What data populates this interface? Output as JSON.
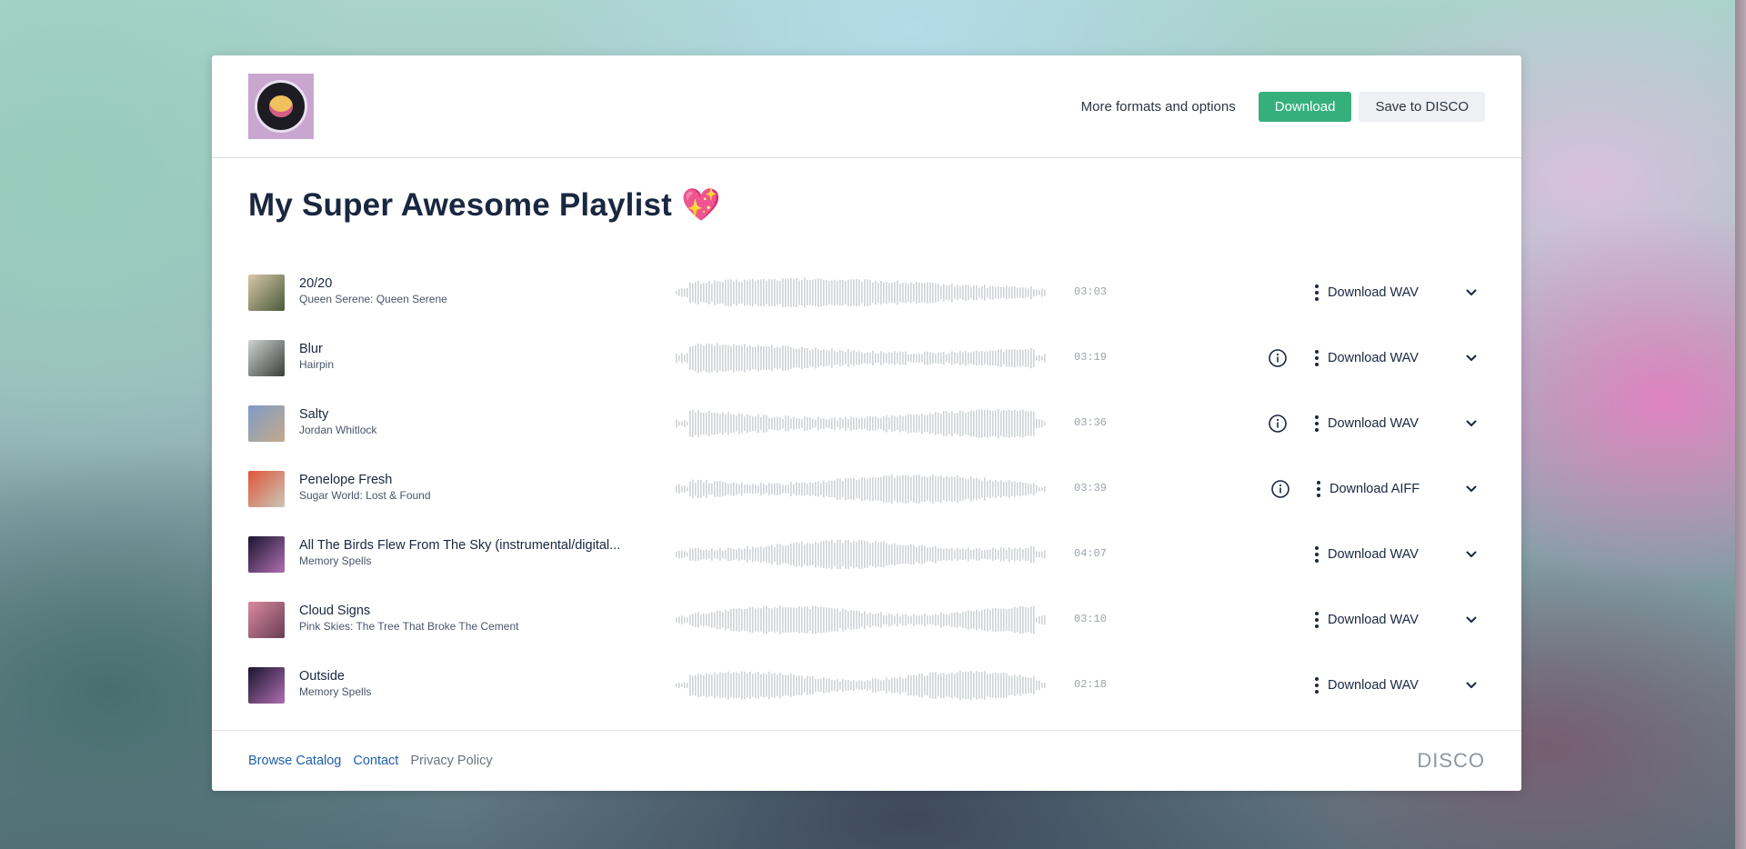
{
  "header": {
    "more_formats_label": "More formats and options",
    "download_label": "Download",
    "save_label": "Save to DISCO"
  },
  "playlist": {
    "title": "My Super Awesome Playlist 💖"
  },
  "tracks": [
    {
      "title": "20/20",
      "subtitle": "Queen Serene: Queen Serene",
      "duration": "03:03",
      "download_label": "Download WAV",
      "has_info": false,
      "art_colors": [
        "#d8c8a8",
        "#4a5a3a"
      ]
    },
    {
      "title": "Blur",
      "subtitle": "Hairpin",
      "duration": "03:19",
      "download_label": "Download WAV",
      "has_info": true,
      "art_colors": [
        "#cfd3d0",
        "#3a3f3c"
      ]
    },
    {
      "title": "Salty",
      "subtitle": "Jordan Whitlock",
      "duration": "03:36",
      "download_label": "Download WAV",
      "has_info": true,
      "art_colors": [
        "#7f9cc7",
        "#c4a98a"
      ]
    },
    {
      "title": "Penelope Fresh",
      "subtitle": "Sugar World: Lost & Found",
      "duration": "03:39",
      "download_label": "Download AIFF",
      "has_info": true,
      "art_colors": [
        "#e0553a",
        "#c9c7b8"
      ]
    },
    {
      "title": "All The Birds Flew From The Sky (instrumental/digital...",
      "subtitle": "Memory Spells",
      "duration": "04:07",
      "download_label": "Download WAV",
      "has_info": false,
      "art_colors": [
        "#1a1530",
        "#b06fb0"
      ]
    },
    {
      "title": "Cloud Signs",
      "subtitle": "Pink Skies: The Tree That Broke The Cement",
      "duration": "03:10",
      "download_label": "Download WAV",
      "has_info": false,
      "art_colors": [
        "#d98aa0",
        "#6a3d52"
      ]
    },
    {
      "title": "Outside",
      "subtitle": "Memory Spells",
      "duration": "02:18",
      "download_label": "Download WAV",
      "has_info": false,
      "art_colors": [
        "#1a1530",
        "#b06fb0"
      ]
    }
  ],
  "footer": {
    "browse_label": "Browse Catalog",
    "contact_label": "Contact",
    "privacy_label": "Privacy Policy",
    "brand": "DISCO"
  },
  "icons": {
    "info": "info-icon",
    "more": "kebab-menu-icon",
    "expand": "chevron-down-icon"
  },
  "colors": {
    "accent_green": "#35b07c",
    "link_blue": "#1f5fa8",
    "title_navy": "#1a2740",
    "waveform_gray": "#cfd2d6"
  }
}
